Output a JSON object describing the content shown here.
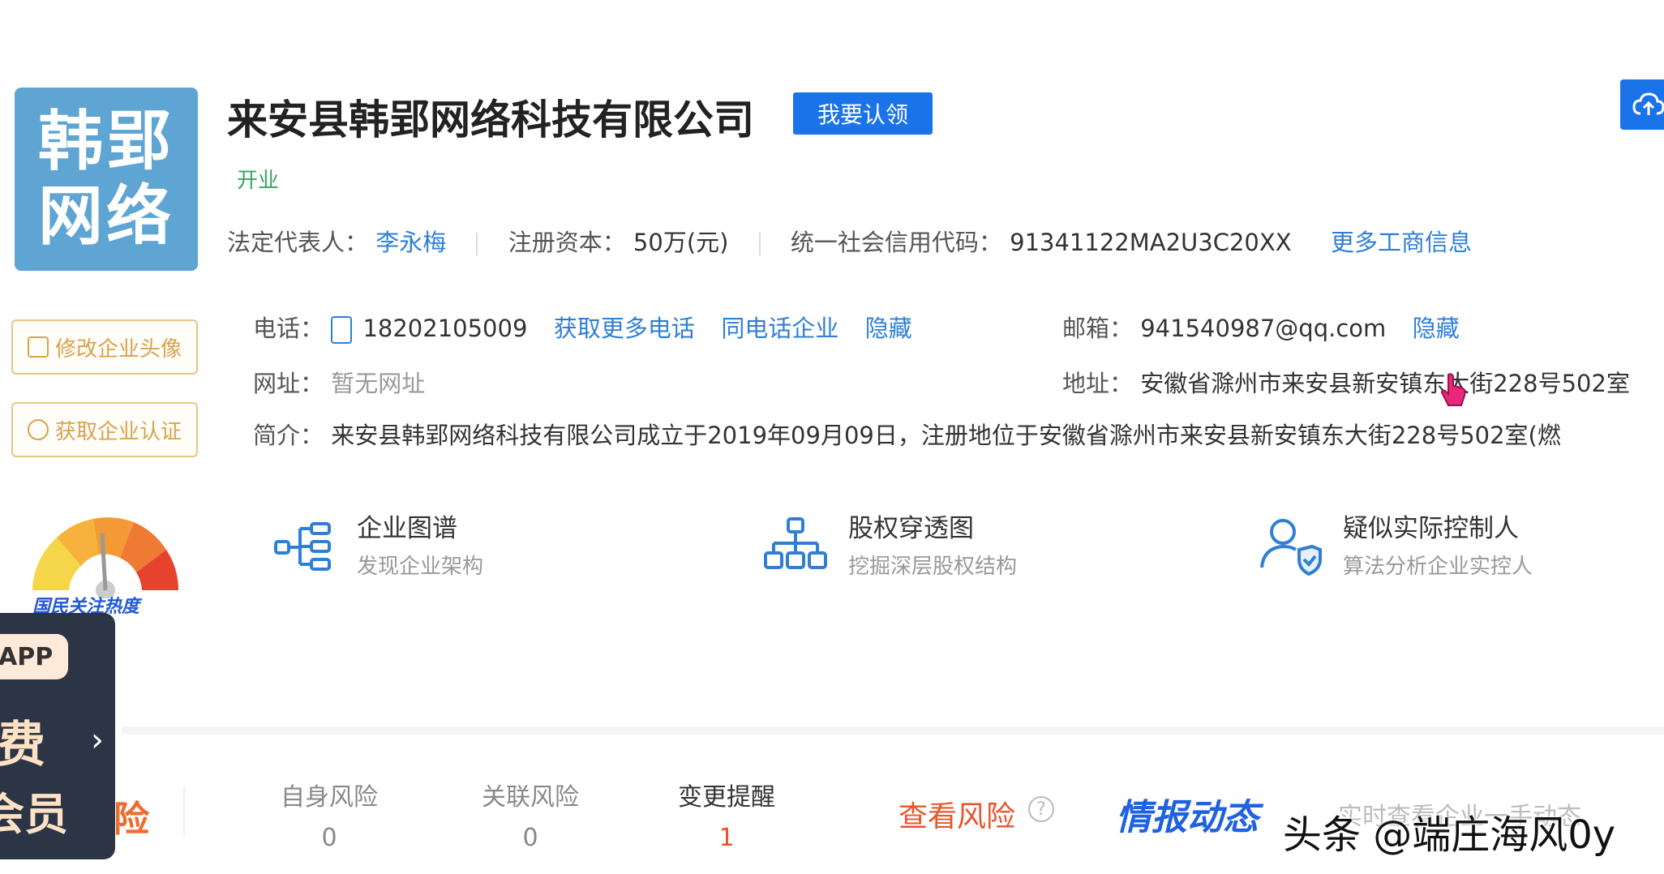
{
  "company": {
    "logo_lines": [
      "韩郢",
      "网络"
    ],
    "name": "来安县韩郢网络科技有限公司",
    "claim_label": "我要认领",
    "status": "开业"
  },
  "side": {
    "change_avatar": "修改企业头像",
    "get_cert": "获取企业认证"
  },
  "basic": {
    "legal_rep_label": "法定代表人：",
    "legal_rep": "李永梅",
    "capital_label": "注册资本：",
    "capital": "50万(元)",
    "credit_code_label": "统一社会信用代码：",
    "credit_code": "91341122MA2U3C20XX",
    "more_info": "更多工商信息"
  },
  "contact": {
    "phone_label": "电话：",
    "phone": "18202105009",
    "more_phone": "获取更多电话",
    "same_phone": "同电话企业",
    "hide_phone": "隐藏",
    "email_label": "邮箱：",
    "email": "941540987@qq.com",
    "hide_email": "隐藏",
    "website_label": "网址：",
    "website": "暂无网址",
    "address_label": "地址：",
    "address": "安徽省滁州市来安县新安镇东大街228号502室",
    "intro_label": "简介：",
    "intro": "来安县韩郢网络科技有限公司成立于2019年09月09日，注册地位于安徽省滁州市来安县新安镇东大街228号502室(燃"
  },
  "features": [
    {
      "title": "企业图谱",
      "subtitle": "发现企业架构"
    },
    {
      "title": "股权穿透图",
      "subtitle": "挖掘深层股权结构"
    },
    {
      "title": "疑似实际控制人",
      "subtitle": "算法分析企业实控人"
    }
  ],
  "gauge_label": "国民关注热度",
  "promo": {
    "app": "APP",
    "fee": "费",
    "vip": "会员",
    "risk_partial": "险"
  },
  "risk_tabs": [
    {
      "name": "自身风险",
      "count": "0"
    },
    {
      "name": "关联风险",
      "count": "0"
    },
    {
      "name": "变更提醒",
      "count": "1"
    }
  ],
  "view_risk": "查看风险",
  "intel_title": "情报动态",
  "intel_desc": "实时查看企业一手动态",
  "watermark": "头条 @端庄海风0y",
  "colors": {
    "primary": "#1a73e8",
    "link": "#2f7fd6",
    "status_green": "#3ba35a",
    "risk_orange": "#e8552e"
  }
}
